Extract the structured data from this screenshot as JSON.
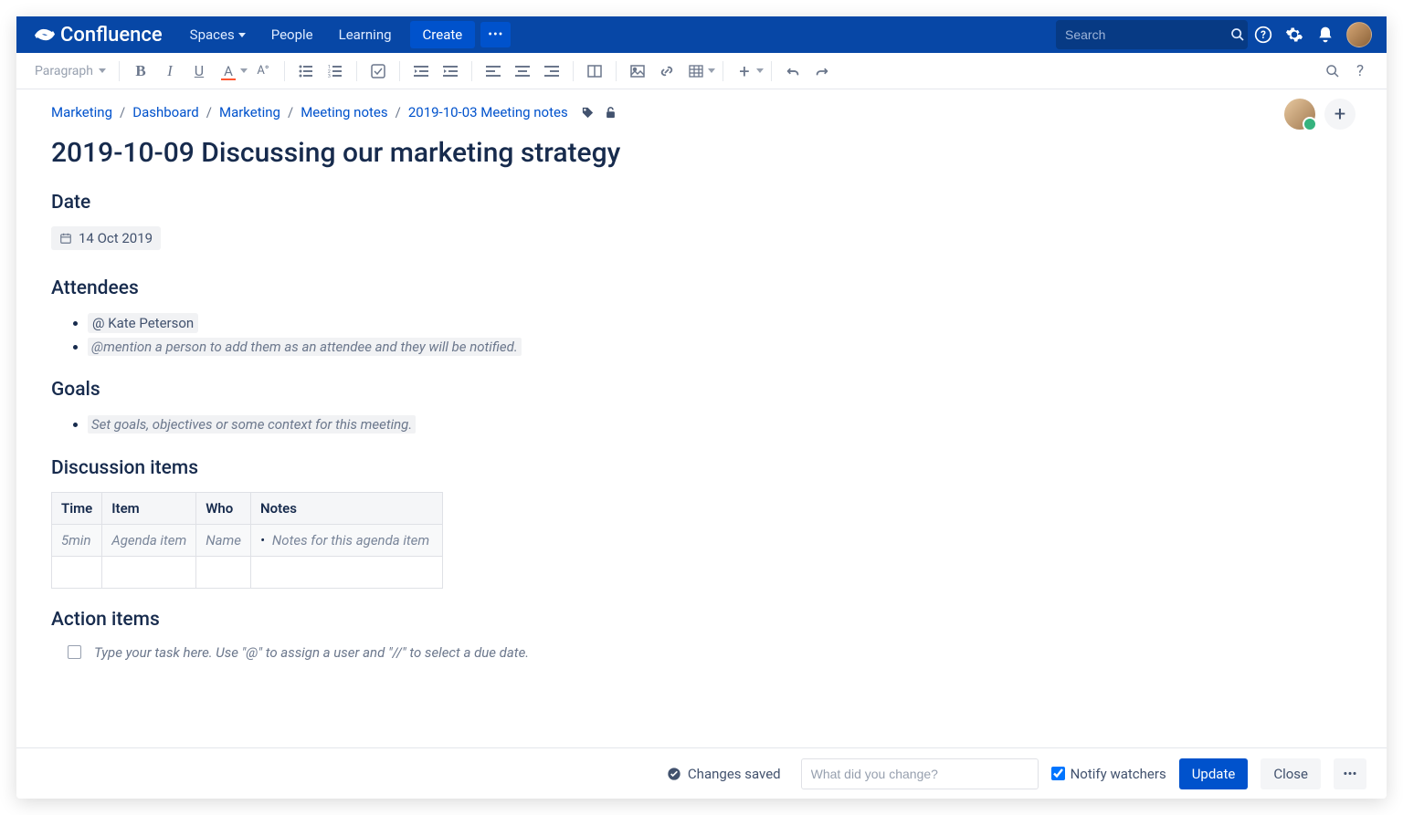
{
  "app": {
    "name": "Confluence"
  },
  "nav": {
    "spaces": "Spaces",
    "people": "People",
    "learning": "Learning",
    "create": "Create",
    "search_placeholder": "Search"
  },
  "toolbar": {
    "paragraph": "Paragraph"
  },
  "breadcrumb": {
    "items": [
      "Marketing",
      "Dashboard",
      "Marketing",
      "Meeting notes",
      "2019-10-03 Meeting notes"
    ]
  },
  "page": {
    "title": "2019-10-09 Discussing our marketing strategy",
    "sections": {
      "date": {
        "heading": "Date",
        "value": "14 Oct 2019"
      },
      "attendees": {
        "heading": "Attendees",
        "mention": "@ Kate Peterson",
        "hint": "@mention a person to add them as an attendee and they will be notified."
      },
      "goals": {
        "heading": "Goals",
        "hint": "Set goals, objectives or some context for this meeting."
      },
      "discussion": {
        "heading": "Discussion items",
        "cols": {
          "time": "Time",
          "item": "Item",
          "who": "Who",
          "notes": "Notes"
        },
        "row1": {
          "time": "5min",
          "item": "Agenda item",
          "who": "Name",
          "notes": "Notes for this agenda item"
        }
      },
      "action": {
        "heading": "Action items",
        "hint": "Type your task here. Use \"@\" to assign a user and \"//\" to select a due date."
      }
    }
  },
  "footer": {
    "saved": "Changes saved",
    "change_placeholder": "What did you change?",
    "notify": "Notify watchers",
    "update": "Update",
    "close": "Close"
  }
}
